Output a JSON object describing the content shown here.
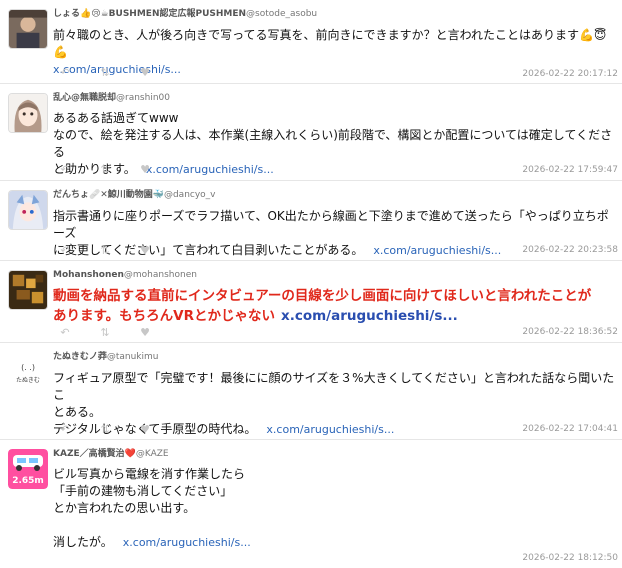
{
  "tweets": [
    {
      "name": "しょる👍😢☕BUSHMEN認定広報PUSHMEN",
      "handle": "@sotode_asobu",
      "lines": [
        "前々職のとき、人が後ろ向きで写ってる写真を、前向きにできますか？と言われたことはあります💪😇💪"
      ],
      "link": "x.com/aruguchieshi/s...",
      "time": "2026-02-22 20:17:12",
      "avatar": "photo-avatar"
    },
    {
      "name": "乱心@無職脱却",
      "handle": "@ranshin00",
      "lines": [
        "あるある話過ぎてwww",
        "なので、絵を発注する人は、本作業(主線入れくらい)前段階で、構図とか配置については確定してくださる",
        "と助かります。"
      ],
      "link": "x.com/aruguchieshi/s...",
      "time": "2026-02-22 17:59:47",
      "avatar": "anime-girl-avatar"
    },
    {
      "name": "だんちょ🩹✕鯨川動物園🐳",
      "handle": "@dancyo_v",
      "lines": [
        "指示書通りに座りポーズでラフ描いて、OK出たから線画と下塗りまで進めて送ったら「やっぱり立ちポーズ",
        "に変更してください」て言われて白目剥いたことがある。"
      ],
      "link": "x.com/aruguchieshi/s...",
      "time": "2026-02-22 20:23:58",
      "avatar": "character-avatar"
    },
    {
      "name": "Mohanshonen",
      "handle": "@mohanshonen",
      "lines": [
        "動画を納品する直前にインタビュアーの目線を少し画面に向けてほしいと言われたことが",
        "あります。もちろんVRとかじゃない"
      ],
      "link": "x.com/aruguchieshi/s...",
      "time": "2026-02-22 18:36:52",
      "avatar": "pixel-avatar"
    },
    {
      "name": "たぬきむノ莽",
      "handle": "@tanukimu",
      "lines": [
        "フィギュア原型で「完璧です！最後にに顔のサイズを３%大きくしてください」と言われた話なら聞いたこ",
        "とある。",
        "デジタルじゃなくて手原型の時代ね。"
      ],
      "link": "x.com/aruguchieshi/s...",
      "time": "2026-02-22 17:04:41",
      "avatar": "logo-avatar",
      "avatar_text": "たぬきむ"
    },
    {
      "name": "KAZE／高橋賢治",
      "handle": "❤️@KAZE",
      "lines": [
        "ビル写真から電線を消す作業したら",
        "「手前の建物も消してください」",
        "とか言われたの思い出す。",
        "",
        "消したが。"
      ],
      "link": "x.com/aruguchieshi/s...",
      "time": "2026-02-22 18:12:50",
      "avatar": "car-avatar",
      "avatar_text": "2.65m"
    }
  ],
  "actions": [
    "↶",
    "⇅",
    "♥"
  ]
}
